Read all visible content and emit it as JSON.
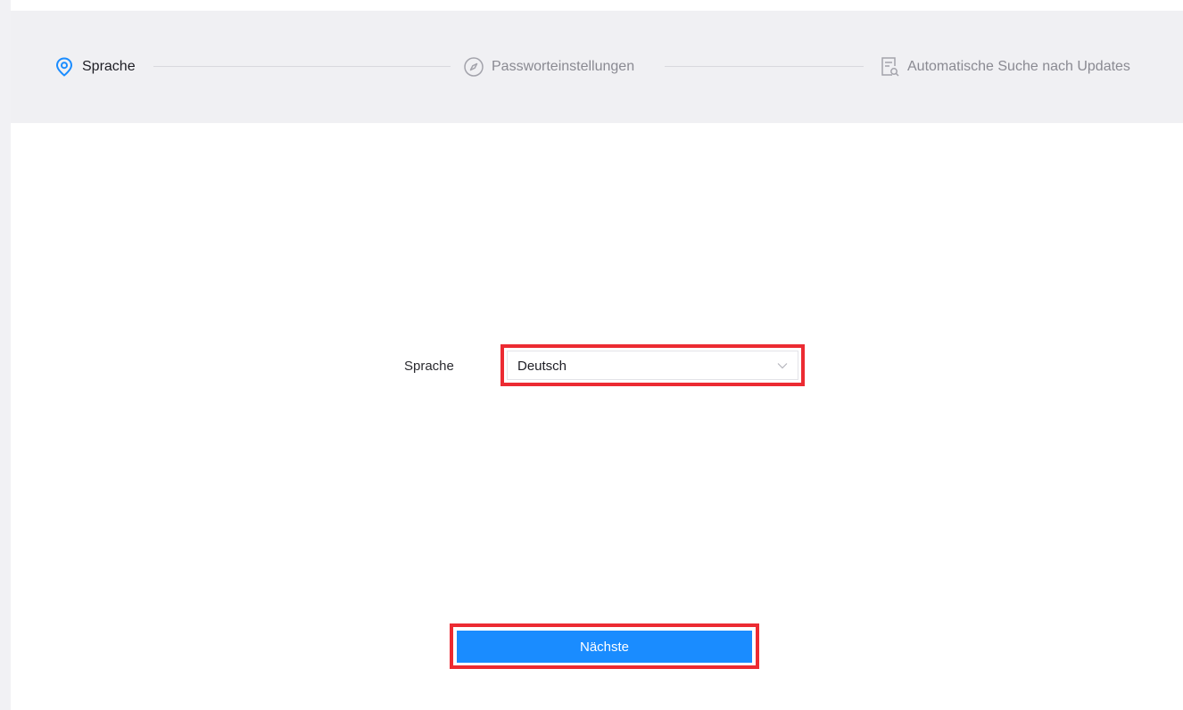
{
  "stepper": {
    "steps": [
      {
        "label": "Sprache",
        "icon": "location-pin-icon",
        "state": "active"
      },
      {
        "label": "Passworteinstellungen",
        "icon": "compass-icon",
        "state": "inactive"
      },
      {
        "label": "Automatische Suche nach Updates",
        "icon": "document-search-icon",
        "state": "inactive"
      }
    ]
  },
  "form": {
    "language_label": "Sprache",
    "language_select": {
      "value": "Deutsch",
      "icon": "chevron-down-icon"
    }
  },
  "actions": {
    "next_label": "Nächste"
  },
  "colors": {
    "accent": "#1a8cff",
    "highlight": "#ec2b32",
    "header_bg": "#f0f0f3"
  }
}
